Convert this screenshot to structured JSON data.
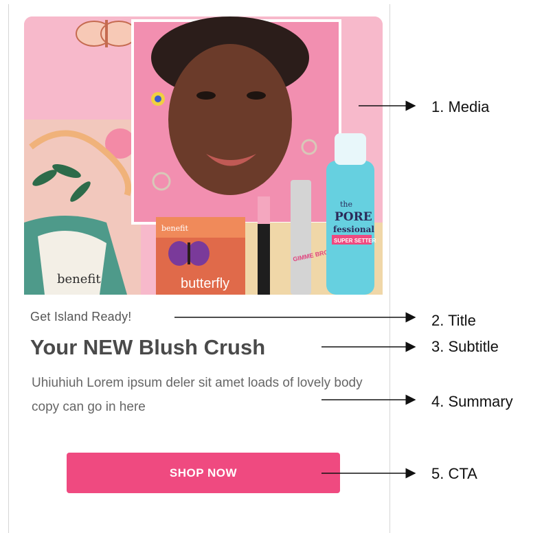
{
  "media": {
    "brand_text": "benefit",
    "palette_label": "butterfly",
    "bottle_text": [
      "the",
      "PORE",
      "fessional",
      "SUPER SETTER"
    ],
    "brow_text": "GIMME BROW+",
    "colors": {
      "background": "#f7b9cb",
      "accent": "#ef4a80",
      "bottle": "#66d0e0"
    }
  },
  "card": {
    "title": "Get Island Ready!",
    "subtitle": "Your NEW Blush Crush",
    "summary": "Uhiuhiuh Lorem ipsum deler sit amet loads of lovely body copy can go in here",
    "cta_label": "SHOP NOW"
  },
  "annotations": [
    {
      "label": "1. Media"
    },
    {
      "label": "2. Title"
    },
    {
      "label": "3. Subtitle"
    },
    {
      "label": "4. Summary"
    },
    {
      "label": "5. CTA"
    }
  ]
}
